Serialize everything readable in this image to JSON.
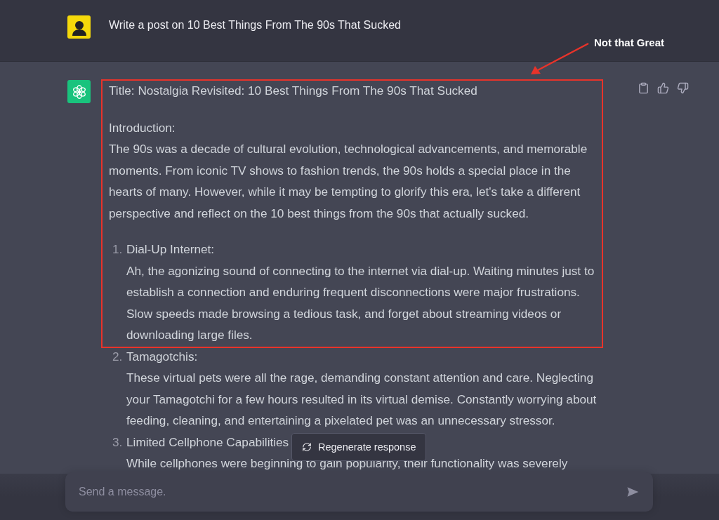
{
  "user_message": {
    "text": "Write a post on 10 Best Things From The 90s That Sucked"
  },
  "annotation": {
    "label": "Not that Great"
  },
  "response": {
    "title": "Title: Nostalgia Revisited: 10 Best Things From The 90s That Sucked",
    "intro_heading": "Introduction:",
    "intro": "The 90s was a decade of cultural evolution, technological advancements, and memorable moments. From iconic TV shows to fashion trends, the 90s holds a special place in the hearts of many. However, while it may be tempting to glorify this era, let's take a different perspective and reflect on the 10 best things from the 90s that actually sucked.",
    "items": [
      {
        "number": "1.",
        "heading": "Dial-Up Internet:",
        "body": "Ah, the agonizing sound of connecting to the internet via dial-up. Waiting minutes just to establish a connection and enduring frequent disconnections were major frustrations. Slow speeds made browsing a tedious task, and forget about streaming videos or downloading large files.",
        "highlighted": true
      },
      {
        "number": "2.",
        "heading": "Tamagotchis:",
        "body": "These virtual pets were all the rage, demanding constant attention and care. Neglecting your Tamagotchi for a few hours resulted in its virtual demise. Constantly worrying about feeding, cleaning, and entertaining a pixelated pet was an unnecessary stressor.",
        "highlighted": false
      },
      {
        "number": "3.",
        "heading": "Limited Cellphone Capabilities",
        "body": "While cellphones were beginning to gain popularity, their functionality was severely",
        "highlighted": false
      }
    ]
  },
  "regenerate_button": {
    "label": "Regenerate response"
  },
  "composer": {
    "placeholder": "Send a message."
  }
}
